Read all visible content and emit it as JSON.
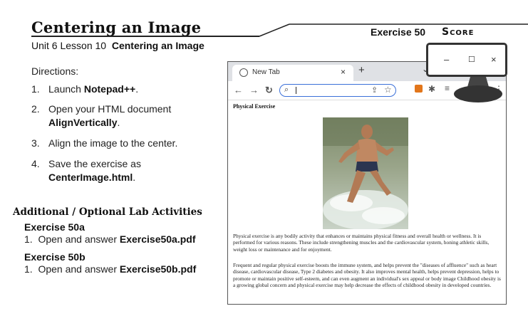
{
  "title": "Centering an Image",
  "subtitle": {
    "unit": "Unit 6 Lesson 10",
    "topic": "Centering an Image"
  },
  "header_right": {
    "exercise": "Exercise 50",
    "score": "Score"
  },
  "directions": {
    "label": "Directions:",
    "steps": [
      {
        "num": "1.",
        "pre": "Launch ",
        "bold": "Notepad++",
        "post": "."
      },
      {
        "num": "2.",
        "pre": "Open your HTML document",
        "bold": "AlignVertically",
        "post": "."
      },
      {
        "num": "3.",
        "pre": "Align the image to the center.",
        "bold": "",
        "post": ""
      },
      {
        "num": "4.",
        "pre": "Save the exercise as",
        "bold": "CenterImage.html",
        "post": "."
      }
    ]
  },
  "additional": {
    "heading": "Additional / Optional Lab Activities",
    "items": [
      {
        "name": "Exercise 50a",
        "num": "1.",
        "pre": "Open and answer ",
        "bold": "Exercise50a.pdf"
      },
      {
        "name": "Exercise 50b",
        "num": "1.",
        "pre": "Open and answer ",
        "bold": "Exercise50b.pdf"
      }
    ]
  },
  "browser": {
    "tab_title": "New Tab",
    "tab_close": "×",
    "new_tab": "+",
    "icons": [
      "back-arrow-icon",
      "forward-arrow-icon",
      "reload-icon",
      "search-icon",
      "share-icon",
      "star-icon",
      "metamask-fox-icon",
      "puzzle-icon",
      "reading-list-icon",
      "kebab-menu-icon"
    ],
    "page": {
      "heading": "Physical Exercise",
      "paragraphs": [
        "Physical exercise is any bodily activity that enhances or maintains physical fitness and overall health or wellness. It is performed for various reasons. These include strengthening muscles and the cardiovascular system, honing athletic skills, weight loss or maintenance and for enjoyment.",
        "Frequent and regular physical exercise boosts the immune system, and helps prevent the \"diseases of affluence\" such as heart disease, cardiovascular disease, Type 2 diabetes and obesity. It also improves mental health, helps prevent depression, helps to promote or maintain positive self-esteem, and can even augment an individual's sex appeal or body image Childhood obesity is a growing global concern and physical exercise may help decrease the effects of childhood obesity in developed countries."
      ]
    }
  },
  "window_controls": {
    "minimize": "–",
    "maximize": "☐",
    "close": "×"
  },
  "colors": {
    "accent_blue": "#3a6fd8",
    "tab_bar": "#dfe1e5",
    "title_text": "#111111"
  }
}
